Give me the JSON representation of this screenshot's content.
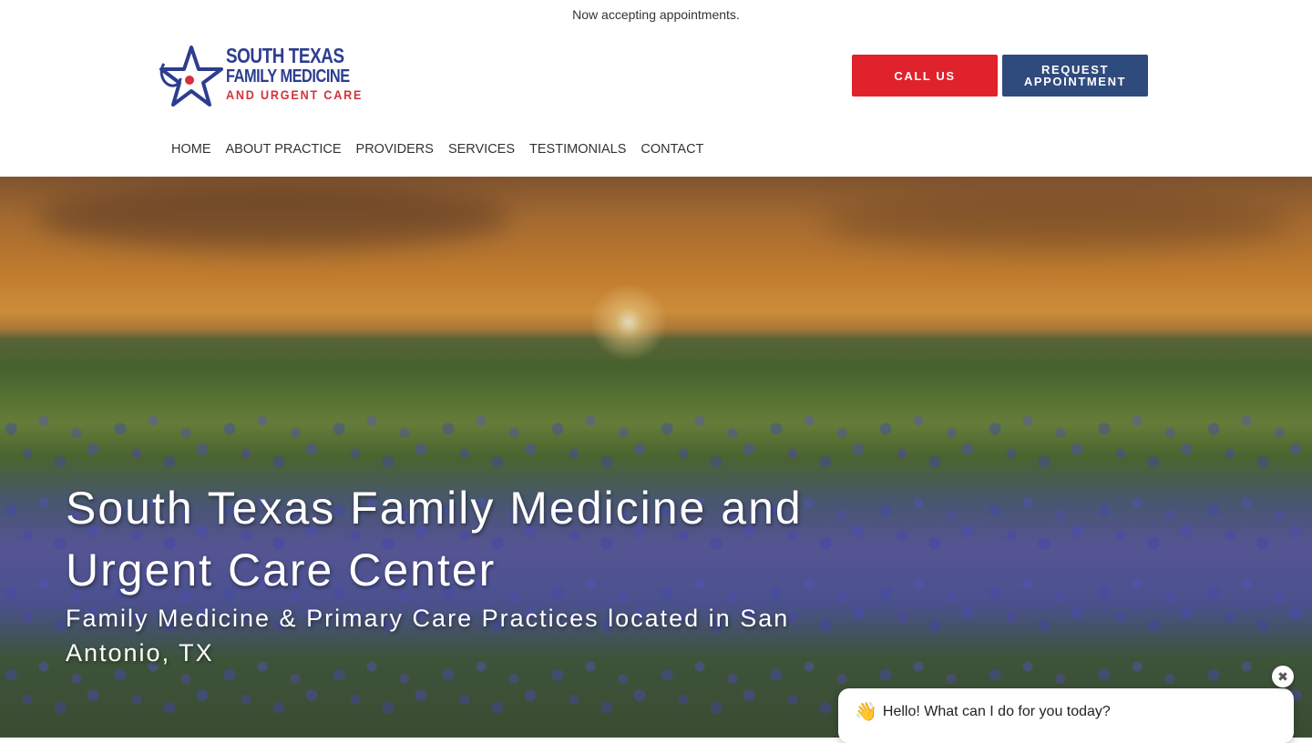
{
  "announcement": "Now accepting appointments.",
  "logo": {
    "line1": "SOUTH TEXAS",
    "line2": "FAMILY MEDICINE",
    "line3": "AND URGENT CARE",
    "icon": "star-stethoscope-icon",
    "colors": {
      "primary": "#2d3d8f",
      "accent": "#d4323a"
    }
  },
  "header_buttons": {
    "call_label": "CALL US",
    "appointment_label": "REQUEST APPOINTMENT",
    "call_color": "#e0222c",
    "appointment_color": "#2f4a7c"
  },
  "nav": {
    "items": [
      {
        "label": "HOME"
      },
      {
        "label": "ABOUT PRACTICE"
      },
      {
        "label": "PROVIDERS"
      },
      {
        "label": "SERVICES"
      },
      {
        "label": "TESTIMONIALS"
      },
      {
        "label": "CONTACT"
      }
    ]
  },
  "hero": {
    "title": "South Texas Family Medicine and Urgent Care Center",
    "subtitle": "Family Medicine & Primary Care Practices located in San Antonio, TX"
  },
  "chat": {
    "greeting_icon": "👋",
    "message": "Hello! What can I do for you today?",
    "close_icon": "✖"
  }
}
